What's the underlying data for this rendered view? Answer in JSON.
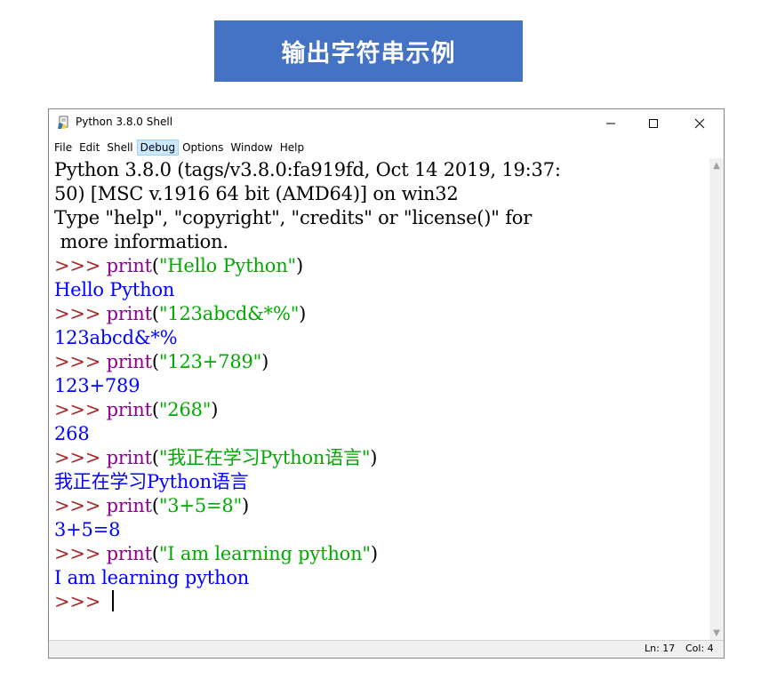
{
  "banner": {
    "title": "输出字符串示例"
  },
  "window": {
    "title": "Python 3.8.0 Shell",
    "icons": {
      "app": "python-idle-icon",
      "minimize": "minimize-icon",
      "maximize": "maximize-icon",
      "close": "close-icon"
    }
  },
  "menu": {
    "items": [
      {
        "label": "File"
      },
      {
        "label": "Edit"
      },
      {
        "label": "Shell"
      },
      {
        "label": "Debug"
      },
      {
        "label": "Options"
      },
      {
        "label": "Window"
      },
      {
        "label": "Help"
      }
    ],
    "active": "Debug"
  },
  "shell": {
    "lines": [
      {
        "type": "info",
        "text": "Python 3.8.0 (tags/v3.8.0:fa919fd, Oct 14 2019, 19:37:"
      },
      {
        "type": "info",
        "text": "50) [MSC v.1916 64 bit (AMD64)] on win32"
      },
      {
        "type": "info",
        "text": "Type \"help\", \"copyright\", \"credits\" or \"license()\" for"
      },
      {
        "type": "info",
        "text": " more information."
      },
      {
        "type": "input",
        "prompt": ">>> ",
        "keyword": "print",
        "open": "(",
        "string": "\"Hello Python\"",
        "close": ")"
      },
      {
        "type": "output",
        "text": "Hello Python"
      },
      {
        "type": "input",
        "prompt": ">>> ",
        "keyword": "print",
        "open": "(",
        "string": "\"123abcd&*%\"",
        "close": ")"
      },
      {
        "type": "output",
        "text": "123abcd&*%"
      },
      {
        "type": "input",
        "prompt": ">>> ",
        "keyword": "print",
        "open": "(",
        "string": "\"123+789\"",
        "close": ")"
      },
      {
        "type": "output",
        "text": "123+789"
      },
      {
        "type": "input",
        "prompt": ">>> ",
        "keyword": "print",
        "open": "(",
        "string": "\"268\"",
        "close": ")"
      },
      {
        "type": "output",
        "text": "268"
      },
      {
        "type": "input",
        "prompt": ">>> ",
        "keyword": "print",
        "open": "(",
        "string": "\"我正在学习Python语言\"",
        "close": ")"
      },
      {
        "type": "output",
        "text": "我正在学习Python语言"
      },
      {
        "type": "input",
        "prompt": ">>> ",
        "keyword": "print",
        "open": "(",
        "string": "\"3+5=8\"",
        "close": ")"
      },
      {
        "type": "output",
        "text": "3+5=8"
      },
      {
        "type": "input",
        "prompt": ">>> ",
        "keyword": "print",
        "open": "(",
        "string": "\"I am learning python\"",
        "close": ")"
      },
      {
        "type": "output",
        "text": "I am learning python"
      },
      {
        "type": "cursor",
        "prompt": ">>> "
      }
    ]
  },
  "status": {
    "line": "Ln: 17",
    "col": "Col: 4"
  },
  "colors": {
    "banner_bg": "#4472c4",
    "keyword": "#900090",
    "string": "#00aa00",
    "output": "#0000ff",
    "prompt": "#a52a2a"
  }
}
